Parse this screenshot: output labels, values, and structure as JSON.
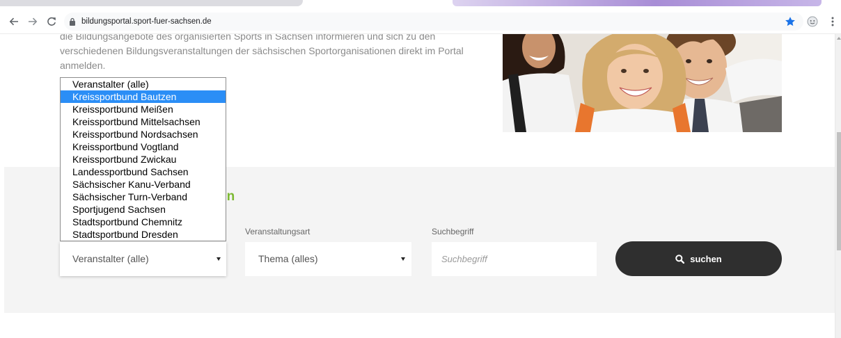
{
  "browser": {
    "url": "bildungsportal.sport-fuer-sachsen.de",
    "icons": {
      "back": "arrow-left-icon",
      "forward": "arrow-right-icon",
      "reload": "reload-icon",
      "secure": "lock-icon",
      "bookmark": "star-icon",
      "extension": "extension-icon",
      "menu": "more-vert-icon"
    }
  },
  "intro": {
    "lines": [
      "die Bildungsangebote des organisierten Sports in Sachsen informieren und sich zu den",
      "verschiedenen Bildungsveranstaltungen der sächsischen Sportorganisationen direkt im Portal",
      "anmelden."
    ]
  },
  "search": {
    "heading": "en",
    "type_label": "Veranstaltungsart",
    "term_label": "Suchbegriff",
    "organizer_select": {
      "value": "Veranstalter (alle)"
    },
    "type_select": {
      "value": "Thema (alles)"
    },
    "term_input": {
      "placeholder": "Suchbegriff"
    },
    "submit": {
      "label": "suchen",
      "icon": "search-icon"
    }
  },
  "organizer_dropdown": {
    "highlighted_index": 1,
    "options": [
      "Veranstalter (alle)",
      "Kreissportbund Bautzen",
      "Kreissportbund Meißen",
      "Kreissportbund Mittelsachsen",
      "Kreissportbund Nordsachsen",
      "Kreissportbund Vogtland",
      "Kreissportbund Zwickau",
      "Landessportbund Sachsen",
      "Sächsischer Kanu-Verband",
      "Sächsischer Turn-Verband",
      "Sportjugend Sachsen",
      "Stadtsportbund Chemnitz",
      "Stadtsportbund Dresden"
    ]
  },
  "colors": {
    "accent_green": "#7cb932",
    "highlight_blue": "#2b8ef6",
    "button_dark": "#2f2f2f",
    "section_gray": "#f4f4f4",
    "bookmark_blue": "#1a73e8"
  }
}
